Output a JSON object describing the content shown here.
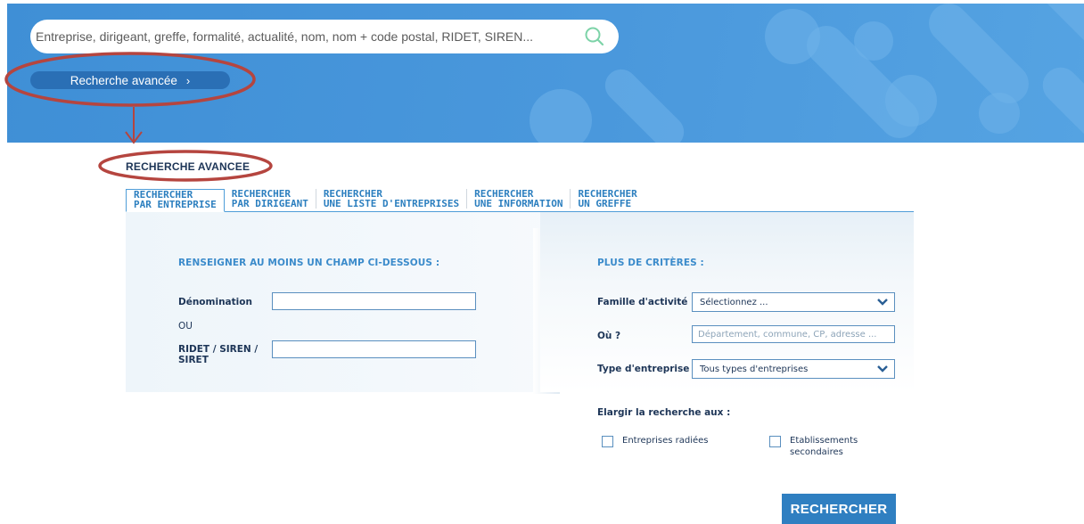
{
  "header": {
    "search_placeholder": "Entreprise, dirigeant, greffe, formalité, actualité, nom, nom + code postal, RIDET, SIREN...",
    "advanced_search_label": "Recherche avancée",
    "advanced_search_chevron": "›"
  },
  "section": {
    "title": "RECHERCHE AVANCEE"
  },
  "tabs": [
    {
      "line1": "RECHERCHER",
      "line2": "PAR ENTREPRISE",
      "active": true
    },
    {
      "line1": "RECHERCHER",
      "line2": "PAR DIRIGEANT",
      "active": false
    },
    {
      "line1": "RECHERCHER",
      "line2": "UNE LISTE D'ENTREPRISES",
      "active": false
    },
    {
      "line1": "RECHERCHER",
      "line2": "UNE INFORMATION",
      "active": false
    },
    {
      "line1": "RECHERCHER",
      "line2": "UN GREFFE",
      "active": false
    }
  ],
  "left_panel": {
    "title": "RENSEIGNER AU MOINS UN CHAMP CI-DESSOUS :",
    "denomination_label": "Dénomination",
    "denomination_value": "",
    "or_label": "OU",
    "ridet_label_line1": "RIDET / SIREN /",
    "ridet_label_line2": "SIRET",
    "ridet_value": ""
  },
  "right_panel": {
    "title": "PLUS DE CRITÈRES :",
    "famille_label": "Famille d'activité",
    "famille_value": "Sélectionnez ...",
    "ou_label": "Où ?",
    "ou_placeholder": "Département, commune, CP, adresse ...",
    "type_label": "Type d'entreprise",
    "type_value": "Tous types d'entreprises",
    "elargir_label": "Elargir la recherche aux :",
    "checkbox_radiees": "Entreprises radiées",
    "checkbox_secondaires_line1": "Etablissements",
    "checkbox_secondaires_line2": "secondaires"
  },
  "submit_label": "RECHERCHER",
  "colors": {
    "banner": "#4a98dc",
    "accent": "#2f7fc1",
    "annotation": "#b5453f"
  }
}
